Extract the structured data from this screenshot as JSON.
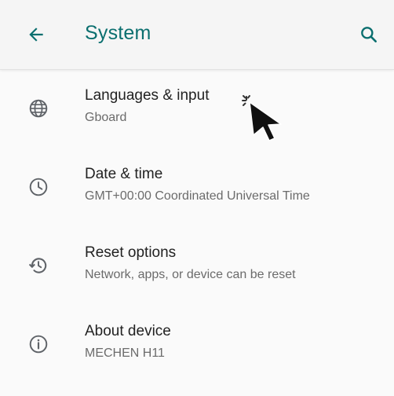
{
  "appbar": {
    "title": "System",
    "back_icon": "arrow-back-icon",
    "search_icon": "search-icon",
    "accent_color": "#0b6f6f"
  },
  "items": [
    {
      "label": "Languages & input",
      "subtitle": "Gboard",
      "icon": "globe-icon"
    },
    {
      "label": "Date & time",
      "subtitle": "GMT+00:00 Coordinated Universal Time",
      "icon": "clock-icon"
    },
    {
      "label": "Reset options",
      "subtitle": "Network, apps, or device can be reset",
      "icon": "restore-icon"
    },
    {
      "label": "About device",
      "subtitle": "MECHEN H11",
      "icon": "info-icon"
    }
  ]
}
